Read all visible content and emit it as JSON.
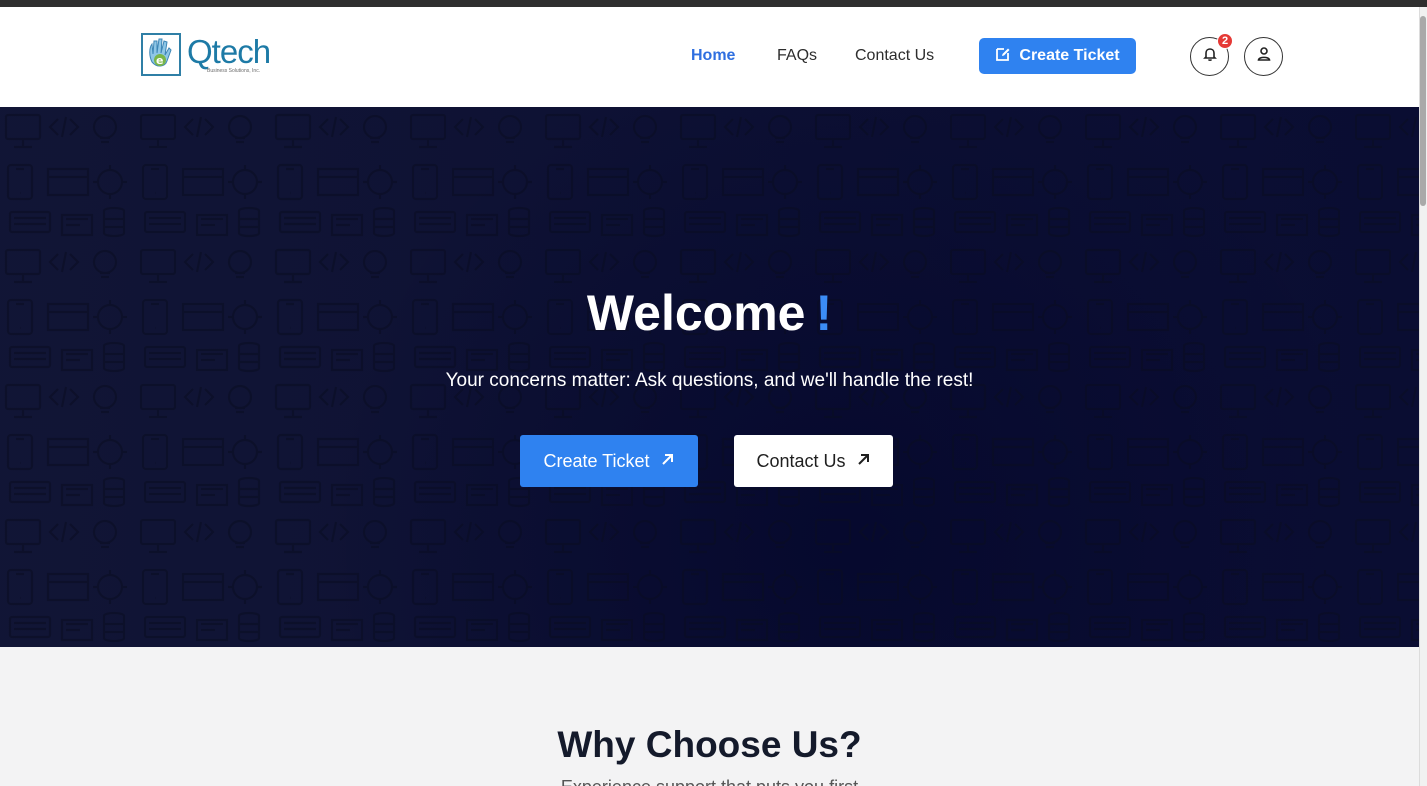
{
  "header": {
    "logo": {
      "name": "Qtech",
      "tagline": "Business Solutions, Inc."
    },
    "nav": [
      {
        "label": "Home",
        "active": true
      },
      {
        "label": "FAQs",
        "active": false
      },
      {
        "label": "Contact Us",
        "active": false
      }
    ],
    "create_ticket_label": "Create Ticket",
    "notifications_count": "2",
    "icons": {
      "create": "edit-icon",
      "bell": "bell-icon",
      "user": "user-icon"
    }
  },
  "hero": {
    "title": "Welcome",
    "title_mark": "!",
    "subtitle": "Your concerns matter: Ask questions, and we'll handle the rest!",
    "primary_button": "Create Ticket",
    "secondary_button": "Contact Us",
    "button_icon": "arrow-up-right-icon"
  },
  "why": {
    "title": "Why Choose Us?",
    "subtitle": "Experience support that puts you first"
  },
  "colors": {
    "accent": "#2f82f0",
    "hero_bg": "#0d1133",
    "nav_active": "#2f6fe0",
    "badge": "#e53935"
  }
}
